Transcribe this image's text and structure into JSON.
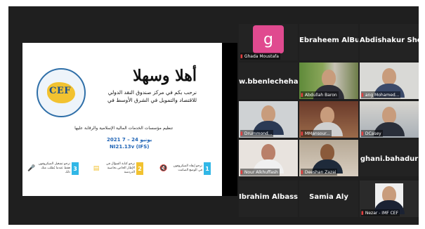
{
  "slide": {
    "title": "أهلا وسهلا",
    "line1": "نرحب بكم في مركز صندوق النقد الدولي",
    "line2": "للاقتصاد والتمويل في الشرق الأوسط في",
    "subtitle": "تنظيم مؤسسات الخدمات المالية الإسلامية والرقابة عليها",
    "date": "2021 يونيو 24 – 7",
    "code": "NI21.13v (IFS)",
    "logo_text": "CEF",
    "tips": [
      {
        "num": "1",
        "text": "نرجو إبقاء الميكروفون في الوضع الصامت",
        "color": "#31b7e6",
        "icon": "mic-off"
      },
      {
        "num": "2",
        "text": "نرجو كتابة السؤال في الإطار الخاص بخاصية الدردشة",
        "color": "#f2c230",
        "icon": "chat"
      },
      {
        "num": "3",
        "text": "نرجو تشغيل الميكروفون فقط عندما يُطلب منك ذلك",
        "color": "#31b7e6",
        "icon": "mic"
      }
    ]
  },
  "participants": [
    {
      "name": "Ghada Moustafa",
      "big": "",
      "type": "avatar",
      "avatar_letter": "g",
      "muted": true
    },
    {
      "name": "",
      "big": "Ebraheem AlBu...",
      "type": "name",
      "muted": false
    },
    {
      "name": "",
      "big": "Abdishakur She...",
      "type": "name",
      "muted": false
    },
    {
      "name": "",
      "big": "w.bbenlechehab",
      "type": "name",
      "muted": false
    },
    {
      "name": "Abdullah Baron",
      "big": "",
      "type": "video",
      "muted": true
    },
    {
      "name": "ang Mohamed...",
      "big": "",
      "type": "video",
      "muted": true
    },
    {
      "name": "Drummond...",
      "big": "",
      "type": "video",
      "muted": true,
      "active": true
    },
    {
      "name": "MMansour...",
      "big": "",
      "type": "video",
      "muted": true
    },
    {
      "name": "DCasey",
      "big": "",
      "type": "video",
      "muted": true
    },
    {
      "name": "Nour Alkhuffash",
      "big": "",
      "type": "video",
      "muted": true
    },
    {
      "name": "Deeshan Zazai",
      "big": "",
      "type": "video",
      "muted": true
    },
    {
      "name": "",
      "big": "ghani.bahadur",
      "type": "name",
      "muted": false
    },
    {
      "name": "",
      "big": "Ibrahim  Albassa...",
      "type": "name",
      "muted": false
    },
    {
      "name": "",
      "big": "Samia Aly",
      "type": "name",
      "muted": false
    },
    {
      "name": "Nezar - IMF CEF",
      "big": "",
      "type": "video",
      "muted": true
    }
  ]
}
